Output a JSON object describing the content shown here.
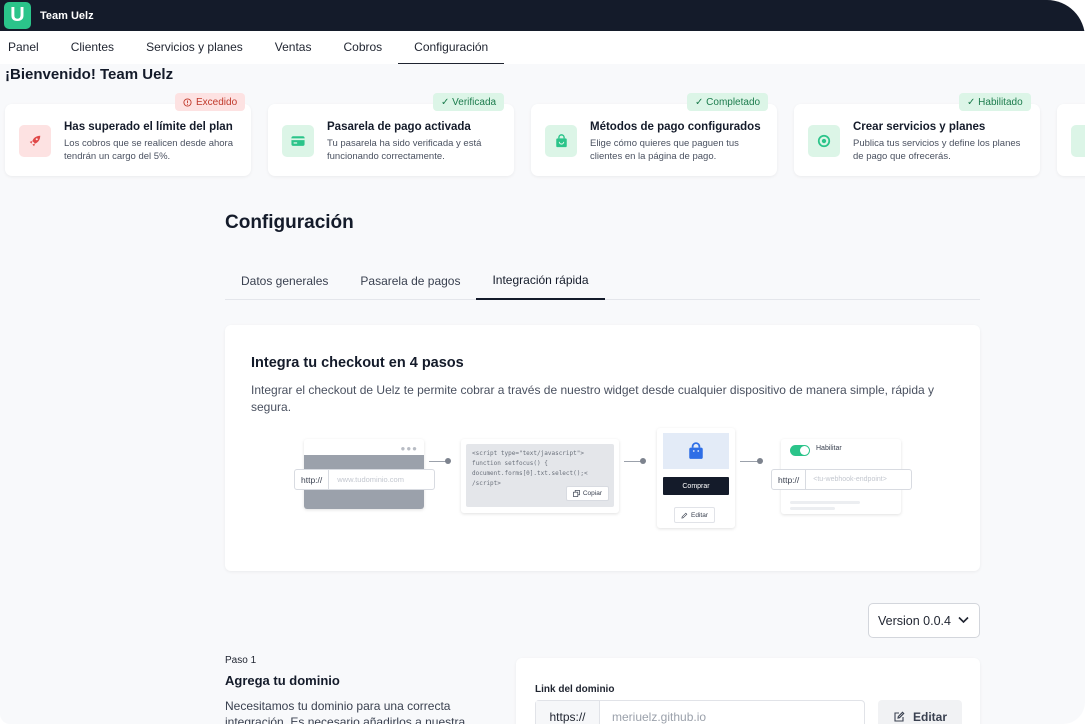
{
  "topbar": {
    "logo_letter": "U",
    "brand": "Team Uelz"
  },
  "nav": {
    "items": [
      {
        "label": "Panel"
      },
      {
        "label": "Clientes"
      },
      {
        "label": "Servicios y planes"
      },
      {
        "label": "Ventas"
      },
      {
        "label": "Cobros"
      },
      {
        "label": "Configuración"
      }
    ],
    "active_index": 5
  },
  "welcome": "¡Bienvenido! Team Uelz",
  "status_cards": [
    {
      "badge": "Excedido",
      "badge_type": "red",
      "title": "Has superado el límite del plan",
      "desc": "Los cobros que se realicen desde ahora tendrán un cargo del 5%.",
      "icon": "rocket-icon",
      "icon_bg": "#fde2e2",
      "icon_color": "#e04848"
    },
    {
      "badge": "✓ Verificada",
      "badge_type": "green",
      "title": "Pasarela de pago activada",
      "desc": "Tu pasarela ha sido verificada y está funcionando correctamente.",
      "icon": "card-icon",
      "icon_bg": "#dcf5e7",
      "icon_color": "#2bc48a"
    },
    {
      "badge": "✓ Completado",
      "badge_type": "green",
      "title": "Métodos de pago configurados",
      "desc": "Elige cómo quieres que paguen tus clientes en la página de pago.",
      "icon": "shopping-bag-icon",
      "icon_bg": "#dcf5e7",
      "icon_color": "#2bc48a"
    },
    {
      "badge": "✓ Habilitado",
      "badge_type": "green",
      "title": "Crear servicios y planes",
      "desc": "Publica tus servicios y define los planes de pago que ofrecerás.",
      "icon": "services-icon",
      "icon_bg": "#dcf5e7",
      "icon_color": "#2bc48a"
    }
  ],
  "page_title": "Configuración",
  "tabs": [
    {
      "label": "Datos generales"
    },
    {
      "label": "Pasarela de pagos"
    },
    {
      "label": "Integración rápida"
    }
  ],
  "active_tab": 2,
  "panel": {
    "title": "Integra tu checkout en 4 pasos",
    "desc": "Integrar el checkout de Uelz te permite cobrar a través de nuestro widget desde cualquier dispositivo de manera simple, rápida y segura."
  },
  "illustration": {
    "url_prefix": "http://",
    "url_placeholder": "www.tudominio.com",
    "code_lines": [
      "<script type=\"text/javascript\">",
      "function setfocus() {",
      "document.forms[0].txt.select();<",
      "/script>"
    ],
    "copy_label": "Copiar",
    "buy_label": "Comprar",
    "edit_label": "Editar",
    "toggle_label": "Habilitar",
    "hook_prefix": "http://",
    "hook_placeholder": "<tu-webhook-endpoint>"
  },
  "version": {
    "selected": "Version 0.0.4"
  },
  "step": {
    "label": "Paso 1",
    "title": "Agrega tu dominio",
    "desc": "Necesitamos tu dominio para una correcta integración. Es necesario añadirlos a nuestra"
  },
  "domain": {
    "label": "Link del dominio",
    "prefix": "https://",
    "value": "meriuelz.github.io",
    "edit_label": "Editar"
  },
  "colors": {
    "dark": "#141b2a",
    "accent": "#2bc48a",
    "danger": "#e04848"
  }
}
